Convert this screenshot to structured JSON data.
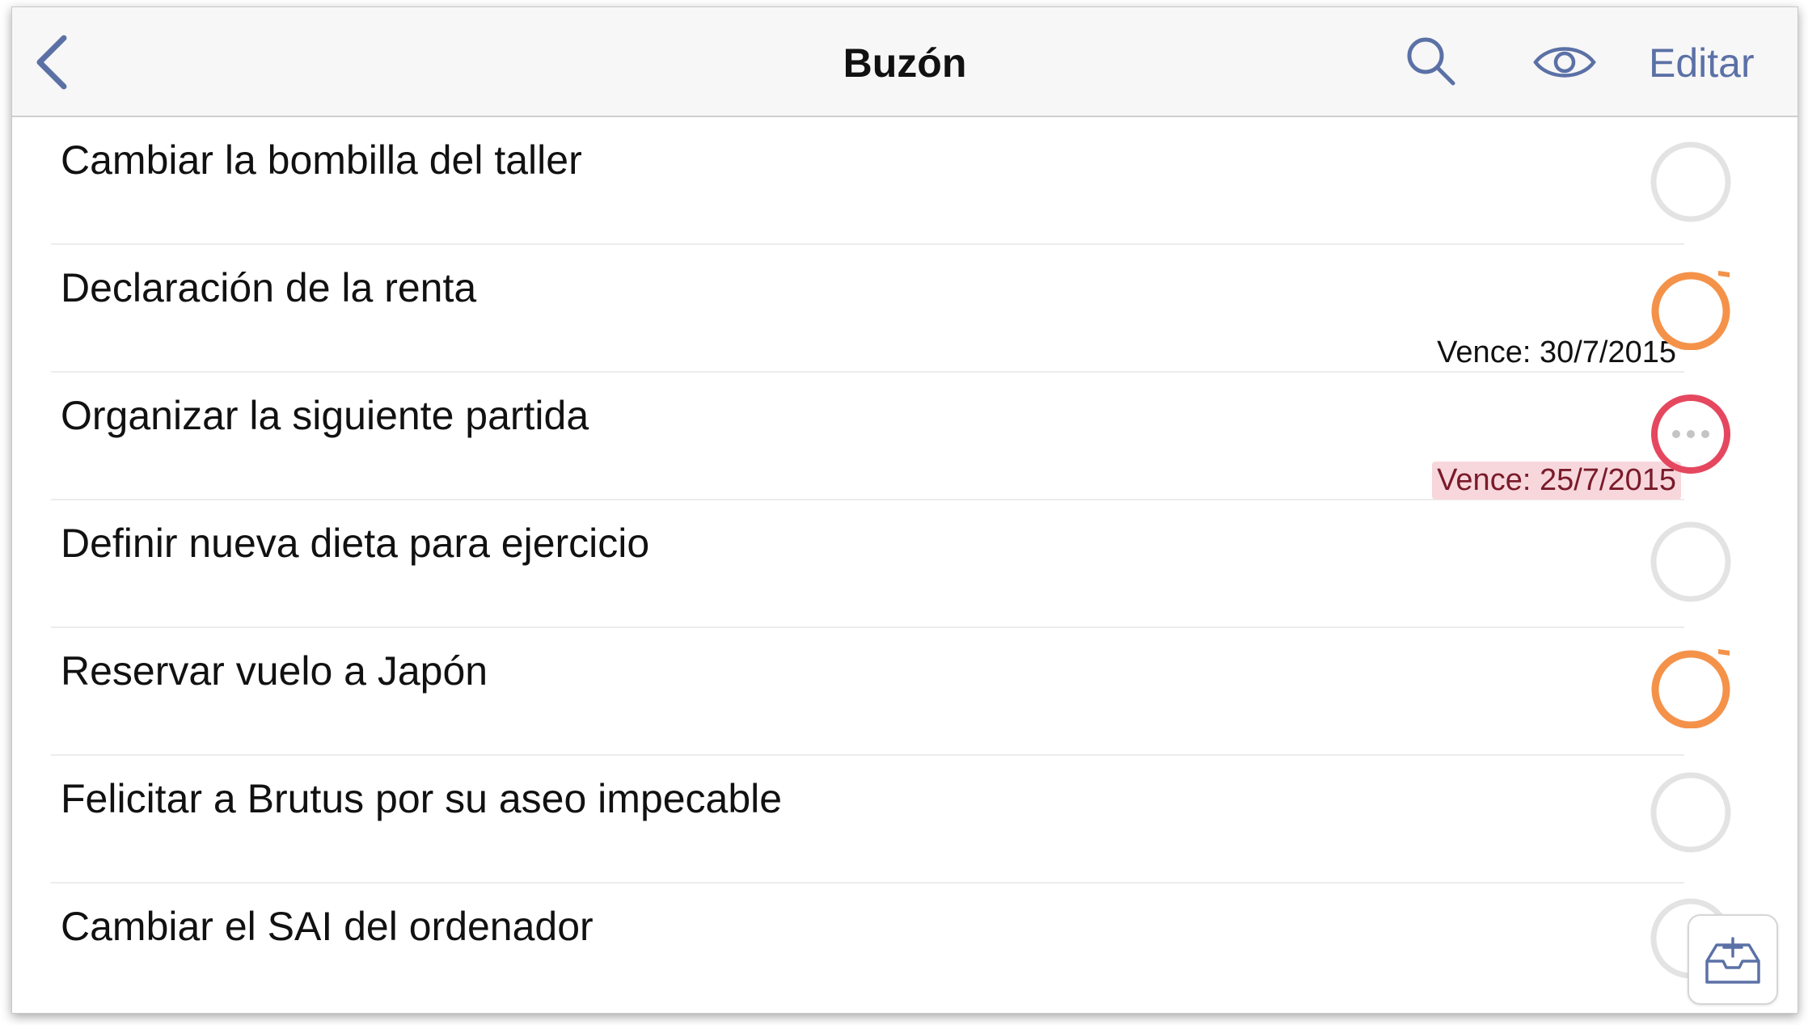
{
  "app": {
    "title": "Buzón"
  },
  "nav": {
    "back_icon": "chevron-left-icon",
    "search_icon": "search-icon",
    "view_icon": "eye-icon",
    "edit_label": "Editar"
  },
  "tasks": [
    {
      "title": "Cambiar la bombilla del taller",
      "due": "",
      "status": "default"
    },
    {
      "title": "Declaración de la renta",
      "due": "Vence: 30/7/2015",
      "status": "flagged"
    },
    {
      "title": "Organizar la siguiente partida",
      "due": "Vence: 25/7/2015",
      "status": "overdue"
    },
    {
      "title": "Definir nueva dieta para ejercicio",
      "due": "",
      "status": "default"
    },
    {
      "title": "Reservar vuelo a Japón",
      "due": "",
      "status": "flagged"
    },
    {
      "title": "Felicitar a Brutus por su aseo impecable",
      "due": "",
      "status": "default"
    },
    {
      "title": "Cambiar el SAI del ordenador",
      "due": "",
      "status": "default"
    }
  ],
  "colors": {
    "accent": "#5b71a6",
    "flagged": "#f4924a",
    "overdue": "#e5475f",
    "default_ring": "#e3e3e3",
    "overdue_bg": "#f7d7dc"
  },
  "add_button": {
    "icon": "inbox-add-icon"
  }
}
